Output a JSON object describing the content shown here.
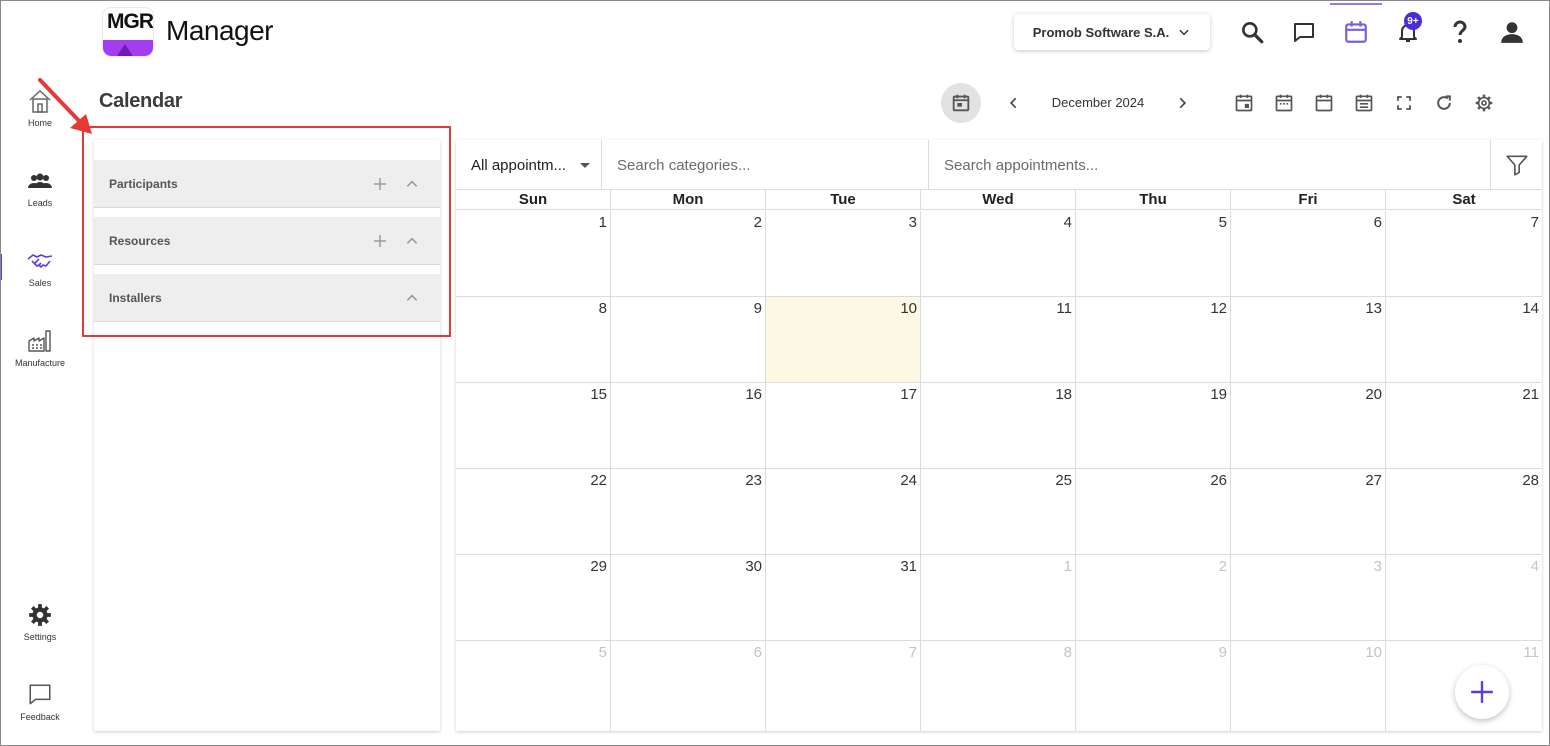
{
  "header": {
    "logo_text": "MGR",
    "app_name": "Manager",
    "company": "Promob Software S.A.",
    "notifications_badge": "9+"
  },
  "rail": {
    "home": "Home",
    "leads": "Leads",
    "sales": "Sales",
    "manufacture": "Manufacture",
    "settings": "Settings",
    "feedback": "Feedback"
  },
  "page": {
    "title": "Calendar"
  },
  "toolbar": {
    "month": "December 2024"
  },
  "left_panel": {
    "sections": [
      {
        "title": "Participants"
      },
      {
        "title": "Resources"
      },
      {
        "title": "Installers"
      }
    ]
  },
  "filters": {
    "appointment_type": "All appointm...",
    "categories_placeholder": "Search categories...",
    "appointments_placeholder": "Search appointments..."
  },
  "calendar": {
    "days_of_week": [
      "Sun",
      "Mon",
      "Tue",
      "Wed",
      "Thu",
      "Fri",
      "Sat"
    ],
    "weeks": [
      [
        "1",
        "2",
        "3",
        "4",
        "5",
        "6",
        "7"
      ],
      [
        "8",
        "9",
        "10",
        "11",
        "12",
        "13",
        "14"
      ],
      [
        "15",
        "16",
        "17",
        "18",
        "19",
        "20",
        "21"
      ],
      [
        "22",
        "23",
        "24",
        "25",
        "26",
        "27",
        "28"
      ],
      [
        "29",
        "30",
        "31",
        "1",
        "2",
        "3",
        "4"
      ],
      [
        "5",
        "6",
        "7",
        "8",
        "9",
        "10",
        "11"
      ]
    ],
    "today": "10"
  }
}
